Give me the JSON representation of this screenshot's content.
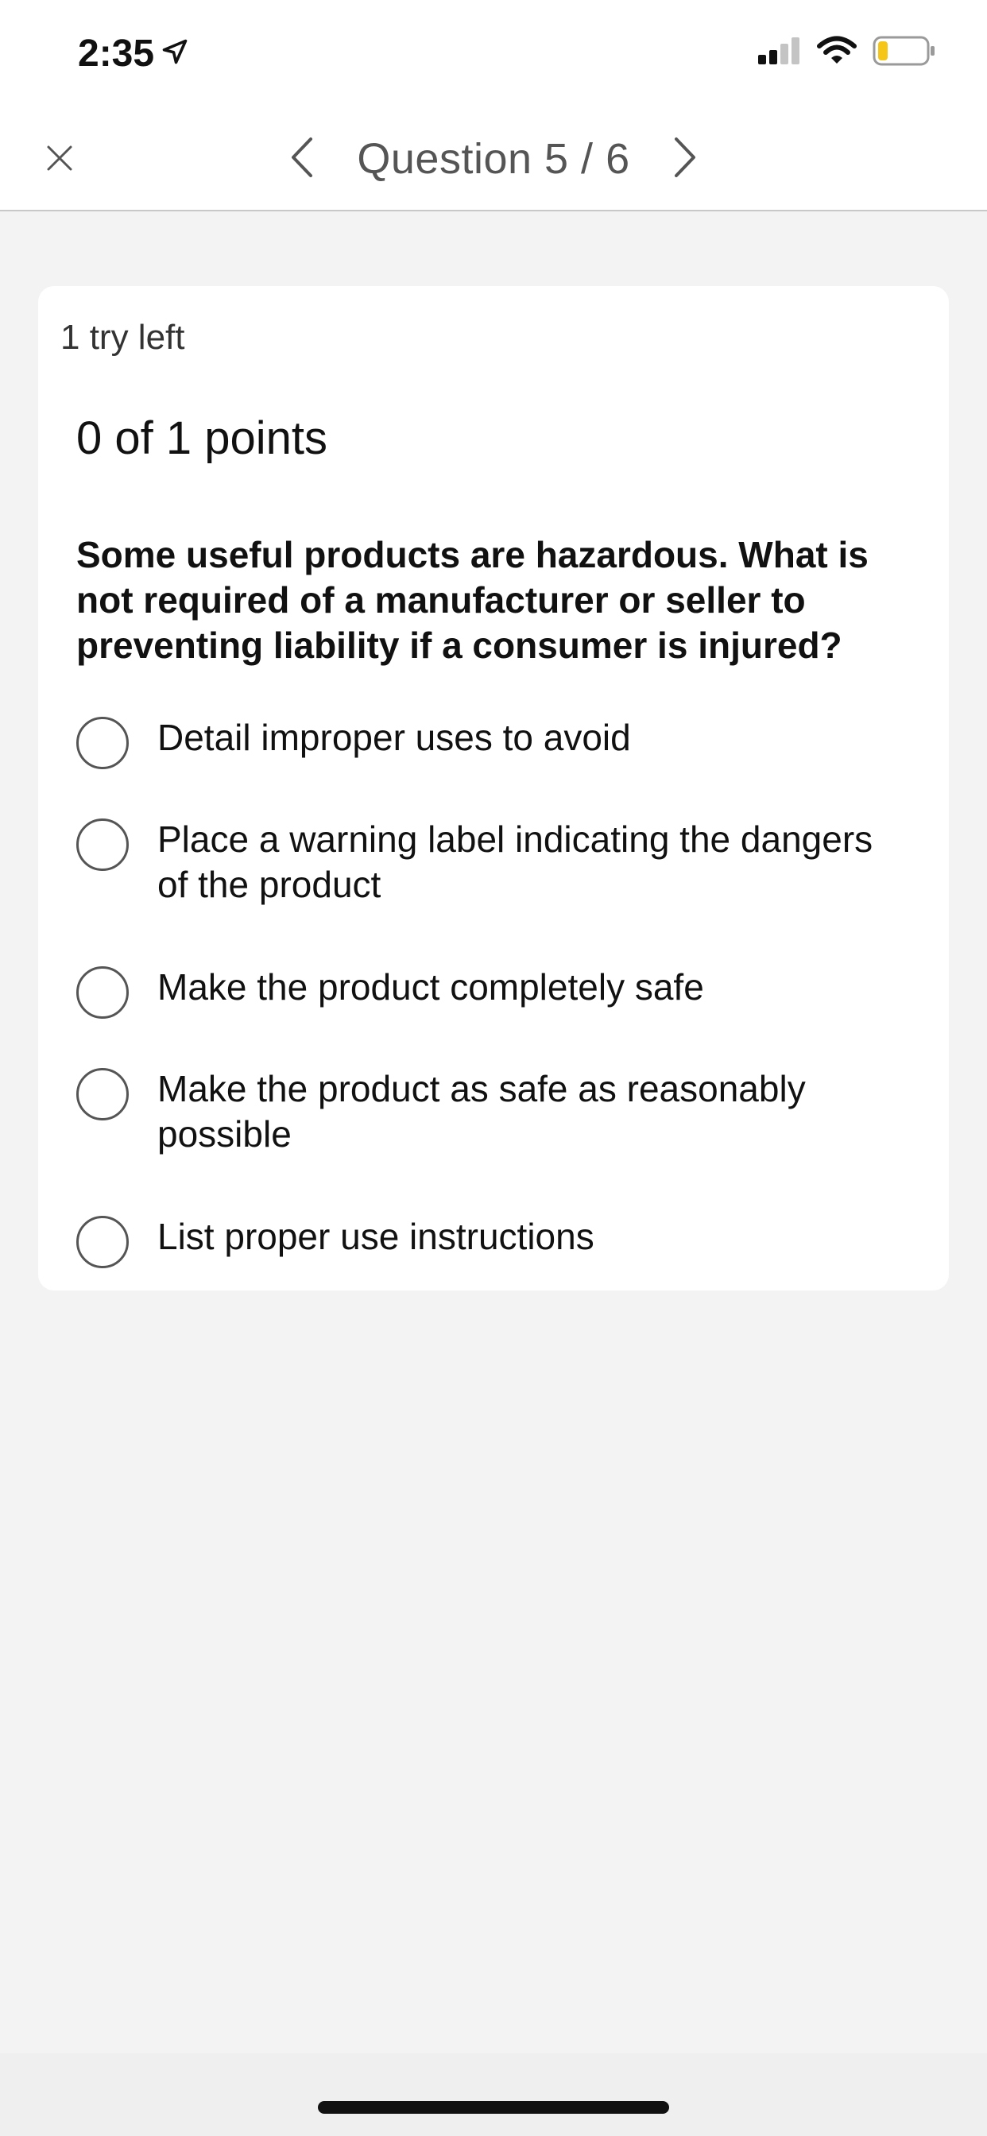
{
  "status_bar": {
    "time": "2:35",
    "location_icon": "location-arrow-icon",
    "signal_icon": "cellular-signal-icon",
    "wifi_icon": "wifi-icon",
    "battery_icon": "battery-icon",
    "battery_level": 0.2,
    "battery_color": "#f5c518"
  },
  "nav": {
    "close_icon": "close-icon",
    "prev_icon": "chevron-left-icon",
    "next_icon": "chevron-right-icon",
    "title": "Question 5 / 6"
  },
  "card": {
    "tries": "1 try left",
    "points": "0 of 1 points",
    "question": "Some useful products are hazardous. What is not required of a manufacturer or seller to preventing liability if a consumer is injured?",
    "options": [
      {
        "label": "Detail improper uses to avoid"
      },
      {
        "label": "Place a warning label indicating the dangers of the product"
      },
      {
        "label": "Make the product completely safe"
      },
      {
        "label": "Make the product as safe as reasonably possible"
      },
      {
        "label": "List proper use instructions"
      }
    ]
  }
}
